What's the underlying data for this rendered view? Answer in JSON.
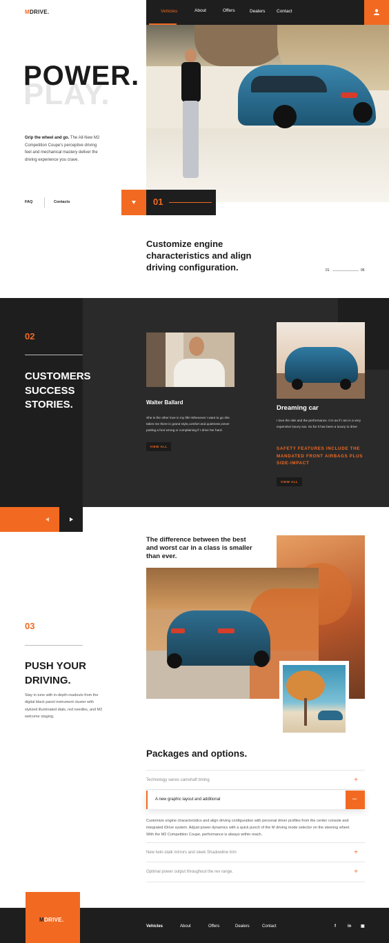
{
  "brand": {
    "logo_m": "M",
    "logo_rest": "DRIVE."
  },
  "nav": {
    "items": [
      "Vehicles",
      "About",
      "Offers",
      "Dealers",
      "Contact"
    ],
    "active": "Vehicles",
    "user_icon": "user-icon"
  },
  "hero": {
    "title_dark": "POWER.",
    "title_light": "PLAY.",
    "lead_bold": "Grip the wheel and go.",
    "lead_text": " The All-New M2 Competition Coupe's perceptive driving feel and mechanical mastery deliver the driving experience you crave.",
    "links": [
      "FAQ",
      "Contacts"
    ],
    "slide_number": "01"
  },
  "customize": {
    "heading": "Customize engine characteristics and align driving configuration.",
    "pager_start": "01",
    "pager_end": "06"
  },
  "stories": {
    "number": "02",
    "heading": "CUSTOMERS SUCCESS STORIES.",
    "card1": {
      "name": "Walter Ballard",
      "text": "She is the other love in my life! Whenever I want to go she takes me there in grand style,comfort and quietness,never putting a foot wrong or complaining if I drive her hard.",
      "button": "VIEW ALL"
    },
    "card2": {
      "name": "Dreaming car",
      "text": "I love the ride and the performance. It is as if I am in a very expensive luxury suv. So far it has been a luxury to drive",
      "highlight": "SAFETY FEATURES INCLUDE THE MANDATED FRONT AIRBAGS PLUS SIDE-IMPACT",
      "button": "VIEW ALL"
    },
    "prev_icon": "arrow-left-icon",
    "next_icon": "arrow-right-icon"
  },
  "push": {
    "quote": "The difference between the best and worst car in a class is smaller than ever.",
    "number": "03",
    "heading": "PUSH YOUR DRIVING.",
    "text": "Stay in tune with in-depth readouts from the digital black panel instrument cluster with stylized illuminated dials, red needles, and M2 welcome staging."
  },
  "packages": {
    "heading": "Packages and options.",
    "items": [
      {
        "label": "Technology vanos camshaft timing",
        "state": "+"
      },
      {
        "label": "A new graphic layout and additional",
        "state": "–"
      },
      {
        "label": "New twin-stalk mirrors and sleek Shadowline trim",
        "state": "+"
      },
      {
        "label": "Optimal power output throughout the rev range.",
        "state": "+"
      }
    ],
    "expanded_text": "Customize engine characteristics and align driving configuration with personal driver profiles from the center console and integrated iDrive system. Adjust power dynamics with a quick punch of the M driving mode selector on the steering wheel. With the M2 Competition Coupe, performance is always within reach."
  },
  "footer": {
    "items": [
      "Vehicles",
      "About",
      "Offers",
      "Dealers",
      "Contact"
    ],
    "social": [
      "facebook-icon",
      "linkedin-icon",
      "instagram-icon"
    ],
    "social_glyphs": [
      "f",
      "in",
      "▣"
    ]
  },
  "colors": {
    "accent": "#f26a21",
    "dark": "#1e1e1e",
    "panel": "#2a2a2a"
  }
}
